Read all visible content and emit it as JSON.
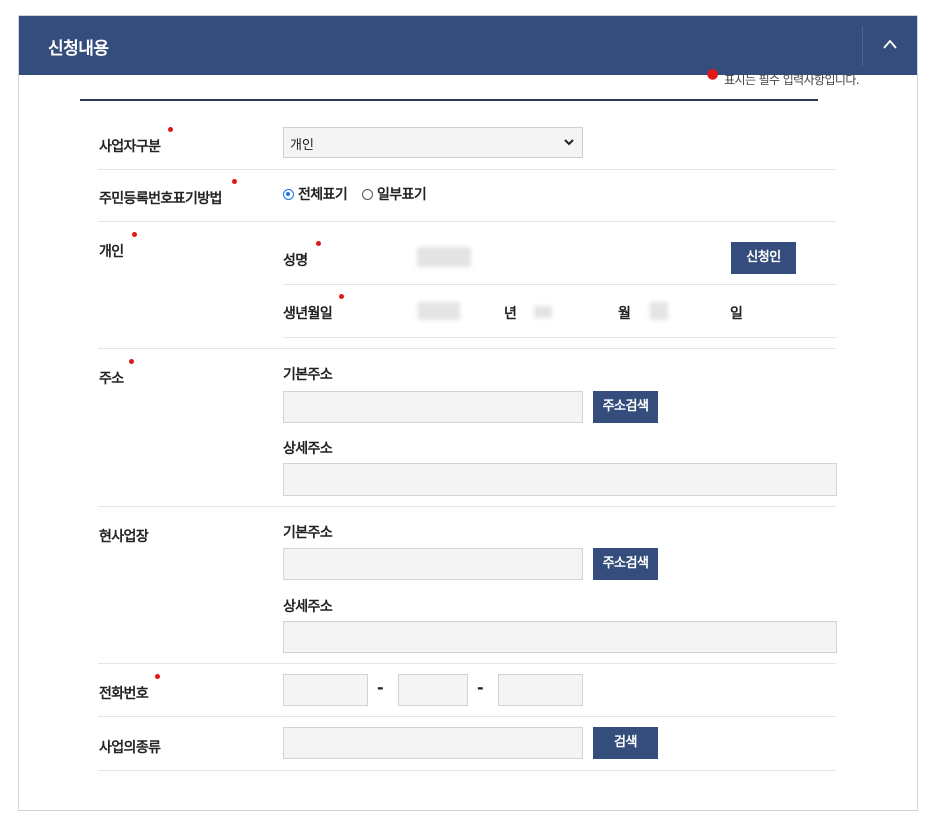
{
  "section": {
    "title": "신청내용",
    "required_note": "표시는 필수 입력사항입니다."
  },
  "business_type": {
    "label": "사업자구분",
    "selected": "개인"
  },
  "rrn_display": {
    "label": "주민등록번호표기방법",
    "options": [
      "전체표기",
      "일부표기"
    ],
    "selected_index": 0
  },
  "individual": {
    "label": "개인",
    "name_label": "성명",
    "applicant_button": "신청인",
    "birth_label": "생년월일",
    "year_unit": "년",
    "month_unit": "월",
    "day_unit": "일"
  },
  "address": {
    "label": "주소",
    "basic_label": "기본주소",
    "search_button": "주소검색",
    "detail_label": "상세주소"
  },
  "worksite": {
    "label": "현사업장",
    "basic_label": "기본주소",
    "search_button": "주소검색",
    "detail_label": "상세주소"
  },
  "phone": {
    "label": "전화번호",
    "separator": "-"
  },
  "business_kind": {
    "label": "사업의종류",
    "search_button": "검색"
  },
  "colors": {
    "header": "#344d7c",
    "button": "#344d7c",
    "required_dot": "#e01818"
  }
}
